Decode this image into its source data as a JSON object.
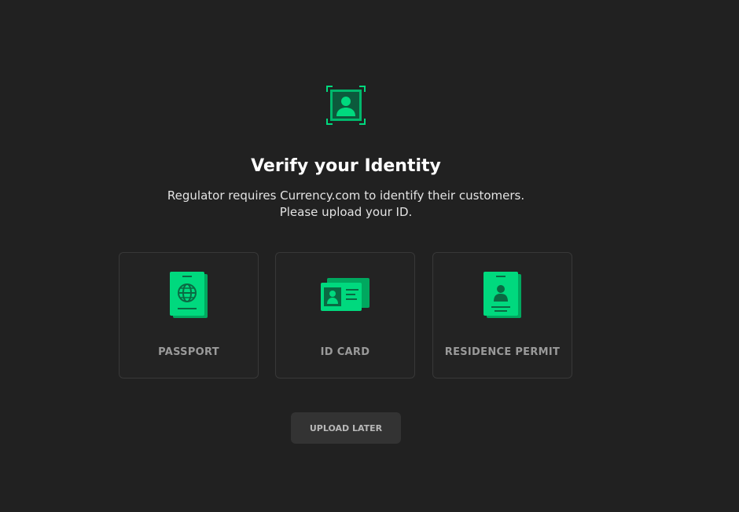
{
  "hero": {
    "icon": "user-id-scan-icon",
    "title": "Verify your Identity",
    "subtitle_line1": "Regulator requires Currency.com to identify their customers.",
    "subtitle_line2": "Please upload your ID."
  },
  "options": [
    {
      "label": "PASSPORT",
      "icon": "passport-icon"
    },
    {
      "label": "ID CARD",
      "icon": "id-card-icon"
    },
    {
      "label": "RESIDENCE PERMIT",
      "icon": "residence-permit-icon"
    }
  ],
  "actions": {
    "upload_later": "UPLOAD LATER"
  },
  "colors": {
    "background": "#212121",
    "accent": "#00d97e",
    "accent_dark": "#00a85f",
    "card_border": "#383838",
    "button_bg": "#333333"
  }
}
